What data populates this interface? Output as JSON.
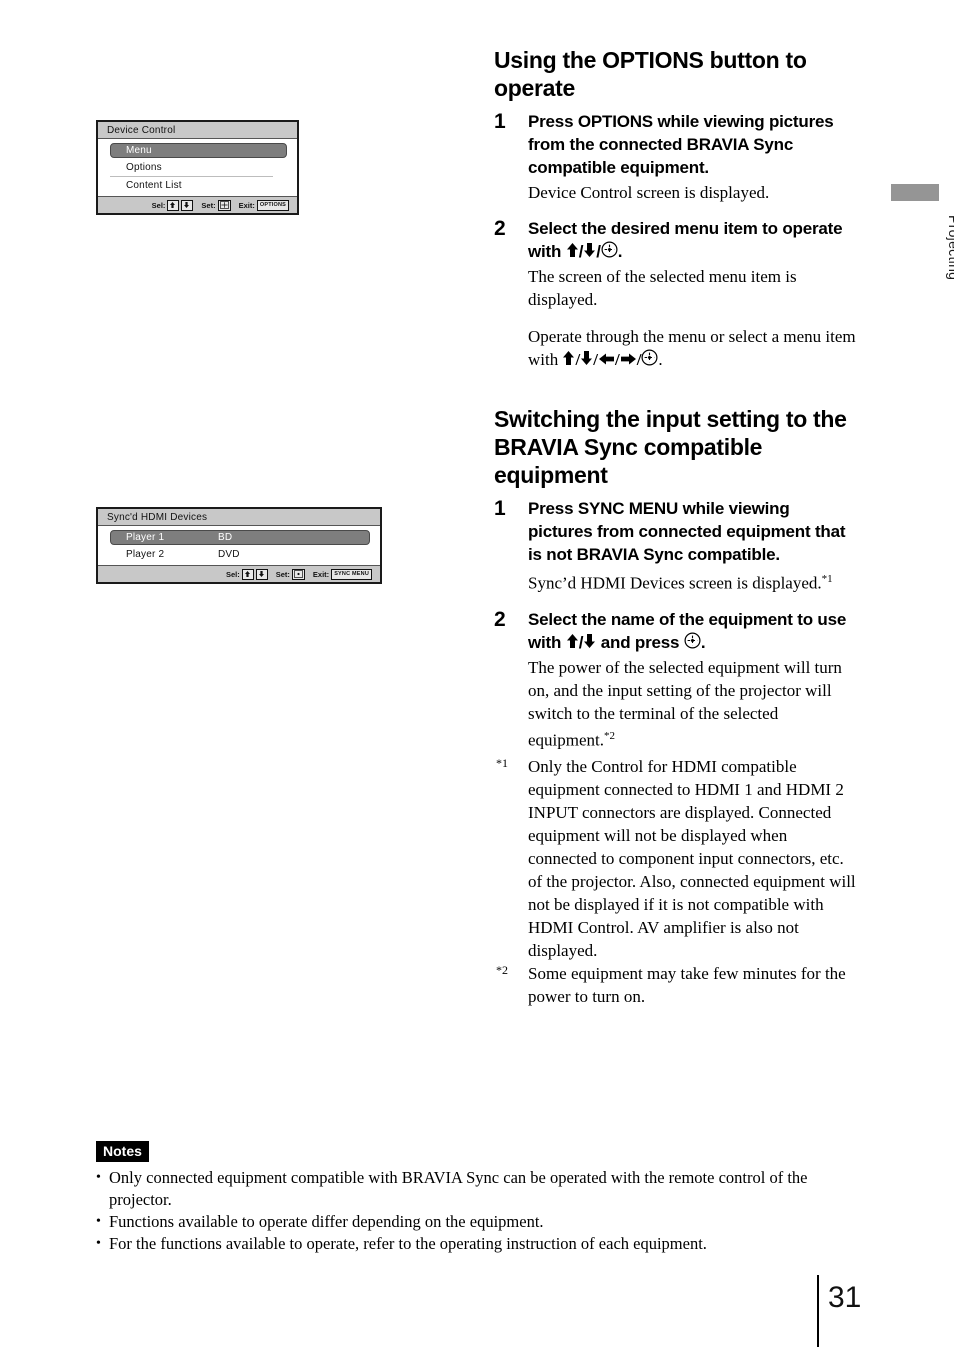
{
  "page": {
    "number": "31",
    "side_tab_label": "Projecting",
    "tab_color": "#959595"
  },
  "osd_device_control": {
    "title": "Device Control",
    "rows": [
      {
        "label": "Menu",
        "value": "",
        "selected": true
      },
      {
        "label": "Options",
        "value": "",
        "selected": false
      },
      {
        "label": "Content List",
        "value": "",
        "selected": false
      }
    ],
    "footer": {
      "sel_label": "Sel:",
      "set_label": "Set:",
      "exit_label": "Exit:",
      "exit_key": "OPTIONS"
    }
  },
  "osd_sync_hdmi": {
    "title": "Sync'd HDMI Devices",
    "rows": [
      {
        "label": "Player 1",
        "value": "BD",
        "selected": true
      },
      {
        "label": "Player 2",
        "value": "DVD",
        "selected": false
      }
    ],
    "footer": {
      "sel_label": "Sel:",
      "set_label": "Set:",
      "exit_label": "Exit:",
      "exit_key": "SYNC MENU"
    }
  },
  "section_options": {
    "heading": "Using the OPTIONS button to operate",
    "step1": {
      "number": "1",
      "head": "Press OPTIONS while viewing pictures from the connected BRAVIA Sync compatible equipment.",
      "body": "Device Control screen is displayed."
    },
    "step2": {
      "number": "2",
      "head_pre": "Select the desired menu item to operate with ",
      "head_post": ".",
      "body1": "The screen of the selected menu item is displayed.",
      "body2_pre": "Operate through the menu or select a menu item with ",
      "body2_post": "."
    }
  },
  "section_switching": {
    "heading": "Switching the input setting to the BRAVIA Sync compatible equipment",
    "step1": {
      "number": "1",
      "head": "Press SYNC MENU while viewing pictures from connected equipment that is not BRAVIA Sync compatible.",
      "body_pre": "Sync’d HDMI Devices screen is displayed.",
      "body_sup": "*1"
    },
    "step2": {
      "number": "2",
      "head_pre": "Select the name of the equipment to use with ",
      "head_mid": " and press ",
      "head_post": ".",
      "body_pre": "The power of the selected equipment will turn on, and the input setting of the projector will switch to the terminal of the selected equipment.",
      "body_sup": "*2"
    },
    "footnotes": [
      {
        "mark": "*1",
        "text": "Only the Control for HDMI compatible equipment connected to HDMI 1 and HDMI 2 INPUT connectors are displayed. Connected equipment will not be displayed when connected to component input connectors, etc. of the projector. Also, connected equipment will not be displayed if it is not compatible with HDMI Control. AV amplifier is also not displayed."
      },
      {
        "mark": "*2",
        "text": "Some equipment may take few minutes for the power to turn on."
      }
    ]
  },
  "notes": {
    "badge": "Notes",
    "items": [
      "Only connected equipment compatible with BRAVIA Sync can be operated with the remote control of the projector.",
      "Functions available to operate differ depending on the equipment.",
      "For the functions available to operate, refer to the operating instruction of each equipment."
    ]
  }
}
